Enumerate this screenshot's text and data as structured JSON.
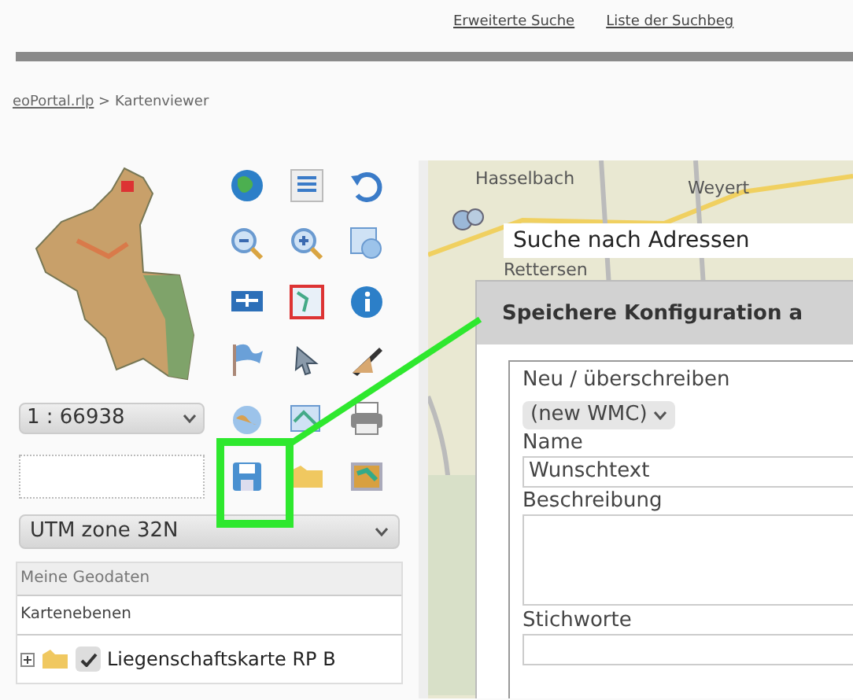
{
  "header_links": [
    "Erweiterte Suche",
    "Liste der Suchbeg"
  ],
  "breadcrumb": {
    "link": "eoPortal.rlp",
    "separator": ">",
    "current": "Kartenviewer"
  },
  "scale_select": {
    "value": "1 : 66938"
  },
  "projection_select": {
    "value": "UTM zone 32N"
  },
  "data_panel": {
    "title": "Meine Geodaten",
    "tab": "Kartenebenen",
    "layers": [
      {
        "label": "Liegenschaftskarte RP B",
        "checked": true,
        "expanded": false
      }
    ]
  },
  "map": {
    "places": [
      "Hasselbach",
      "Weyert",
      "Rettersen"
    ],
    "search": {
      "value": "Suche nach Adressen"
    }
  },
  "dialog": {
    "title": "Speichere Konfiguration a",
    "fields": [
      {
        "kind": "select",
        "label": "Neu / überschreiben",
        "value": "(new WMC)"
      },
      {
        "kind": "text",
        "label": "Name",
        "value": "Wunschtext"
      },
      {
        "kind": "textarea",
        "label": "Beschreibung"
      },
      {
        "kind": "text",
        "label": "Stichworte"
      }
    ]
  }
}
